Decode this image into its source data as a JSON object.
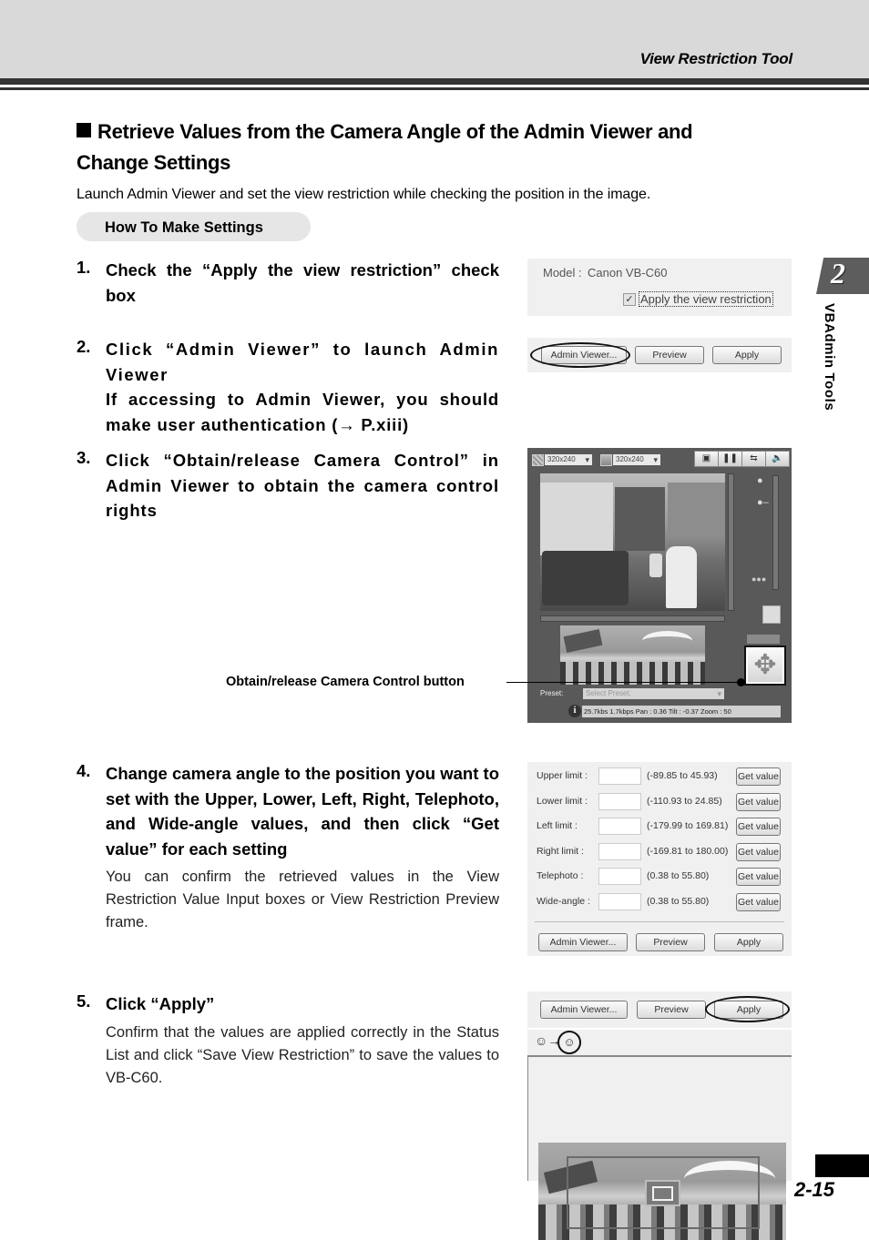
{
  "header": {
    "title": "View Restriction Tool"
  },
  "section": {
    "title": "Retrieve Values from the Camera Angle of the Admin Viewer and Change Settings",
    "intro": "Launch Admin Viewer and set the view restriction while checking the position in the image.",
    "how_to_label": "How To Make Settings"
  },
  "steps": [
    {
      "num": "1.",
      "heading": "Check the “Apply the view restriction” check box"
    },
    {
      "num": "2.",
      "heading_line1": "Click “Admin Viewer” to launch Admin Viewer",
      "heading_line2": "If accessing to Admin Viewer, you should make user authentication (→ P.xiii)"
    },
    {
      "num": "3.",
      "heading": "Click “Obtain/release Camera Control” in Admin Viewer to obtain the camera control rights"
    },
    {
      "num": "4.",
      "heading": "Change camera angle to the position you want to set with the Upper, Lower, Left, Right, Telephoto, and Wide-angle values, and then click “Get value” for each setting",
      "body": "You can confirm the retrieved values in the View Restriction Value Input boxes or View Restriction Preview frame."
    },
    {
      "num": "5.",
      "heading": "Click “Apply”",
      "body": "Confirm that the values are applied correctly in the Status List and click “Save View Restriction” to save the values to VB-C60."
    }
  ],
  "side_tab": {
    "chapter": "2",
    "label": "VBAdmin Tools"
  },
  "footer": {
    "page": "2-15"
  },
  "callout": {
    "label": "Obtain/release Camera Control button"
  },
  "screens": {
    "model": {
      "label": "Model :",
      "value": "Canon VB-C60",
      "checkbox_label": "Apply the view restriction",
      "checked": true
    },
    "buttons": {
      "admin_viewer": "Admin Viewer...",
      "preview": "Preview",
      "apply": "Apply"
    },
    "viewer": {
      "size1": "320x240",
      "size2": "320x240",
      "toolbar_icons": [
        "fit-icon",
        "pause-icon",
        "swap-icon",
        "speaker-icon"
      ],
      "preset_label": "Preset:",
      "preset_placeholder": "Select Preset.",
      "status": "25.7kbs 1.7kbps Pan : 0.36 Tilt : -0.37 Zoom : 50",
      "info_glyph": "i",
      "move_glyph": "✥"
    },
    "limits": {
      "get_value": "Get value",
      "rows": [
        {
          "label": "Upper limit :",
          "range": "(-89.85 to 45.93)"
        },
        {
          "label": "Lower limit :",
          "range": "(-110.93 to 24.85)"
        },
        {
          "label": "Left limit :",
          "range": "(-179.99 to 169.81)"
        },
        {
          "label": "Right limit :",
          "range": "(-169.81 to 180.00)"
        },
        {
          "label": "Telephoto :",
          "range": "(0.38 to 55.80)"
        },
        {
          "label": "Wide-angle :",
          "range": "(0.38 to 55.80)"
        }
      ]
    }
  }
}
